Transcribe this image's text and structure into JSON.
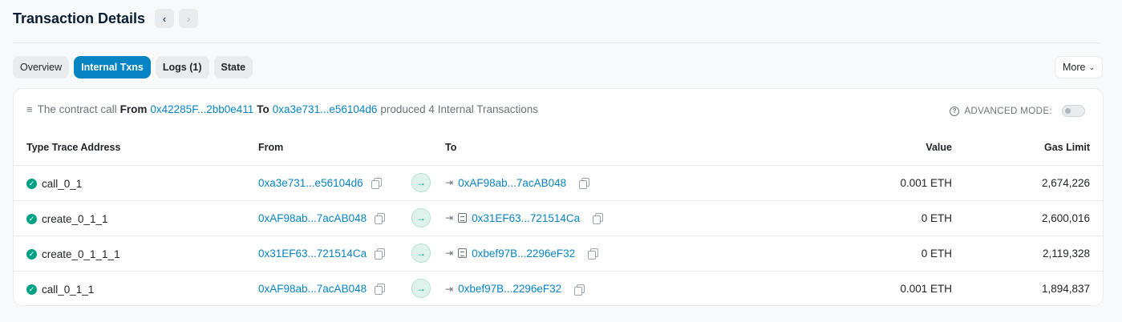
{
  "header": {
    "title": "Transaction Details",
    "prev_icon": "‹",
    "next_icon": "›"
  },
  "tabs": [
    {
      "label": "Overview",
      "active": false
    },
    {
      "label": "Internal Txns",
      "active": true
    },
    {
      "label": "Logs (1)",
      "active": false
    },
    {
      "label": "State",
      "active": false
    }
  ],
  "more_label": "More",
  "summary": {
    "prefix": "The contract call",
    "from_label": "From",
    "from_addr": "0x42285F...2bb0e411",
    "to_label": "To",
    "to_addr": "0xa3e731...e56104d6",
    "suffix": "produced 4 Internal Transactions"
  },
  "advanced_mode": {
    "label": "ADVANCED MODE:",
    "enabled": false
  },
  "table": {
    "headers": {
      "type": "Type Trace Address",
      "from": "From",
      "to": "To",
      "value": "Value",
      "gas": "Gas Limit"
    },
    "rows": [
      {
        "type": "call_0_1",
        "from": "0xa3e731...e56104d6",
        "to": "0xAF98ab...7acAB048",
        "to_is_contract": false,
        "value": "0.001 ETH",
        "gas": "2,674,226"
      },
      {
        "type": "create_0_1_1",
        "from": "0xAF98ab...7acAB048",
        "to": "0x31EF63...721514Ca",
        "to_is_contract": true,
        "value": "0 ETH",
        "gas": "2,600,016"
      },
      {
        "type": "create_0_1_1_1",
        "from": "0x31EF63...721514Ca",
        "to": "0xbef97B...2296eF32",
        "to_is_contract": true,
        "value": "0 ETH",
        "gas": "2,119,328"
      },
      {
        "type": "call_0_1_1",
        "from": "0xAF98ab...7acAB048",
        "to": "0xbef97B...2296eF32",
        "to_is_contract": false,
        "value": "0.001 ETH",
        "gas": "1,894,837"
      }
    ]
  },
  "colors": {
    "accent": "#0784c3",
    "success": "#00a186"
  }
}
